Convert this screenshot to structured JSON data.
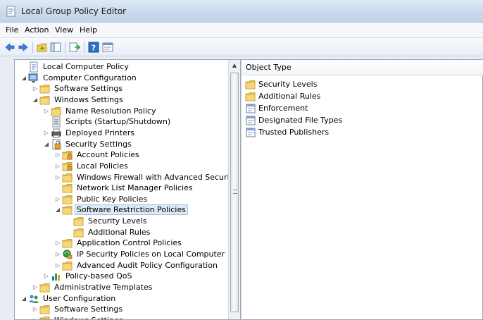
{
  "window": {
    "title": "Local Group Policy Editor"
  },
  "menu": [
    "File",
    "Action",
    "View",
    "Help"
  ],
  "toolbar": {
    "buttons": [
      "back-icon",
      "forward-icon",
      "up-folder-icon",
      "show-hide-tree-icon",
      "export-list-icon",
      "help-icon",
      "properties-icon"
    ]
  },
  "tree": {
    "items": [
      {
        "label": "Local Computer Policy",
        "level": 0,
        "expander": "none",
        "icon": "policy"
      },
      {
        "label": "Computer Configuration",
        "level": 0,
        "expander": "expanded",
        "icon": "computer"
      },
      {
        "label": "Software Settings",
        "level": 1,
        "expander": "collapsed",
        "icon": "folder"
      },
      {
        "label": "Windows Settings",
        "level": 1,
        "expander": "expanded",
        "icon": "folder"
      },
      {
        "label": "Name Resolution Policy",
        "level": 2,
        "expander": "collapsed",
        "icon": "folder"
      },
      {
        "label": "Scripts (Startup/Shutdown)",
        "level": 2,
        "expander": "none",
        "icon": "script"
      },
      {
        "label": "Deployed Printers",
        "level": 2,
        "expander": "collapsed",
        "icon": "printer"
      },
      {
        "label": "Security Settings",
        "level": 2,
        "expander": "expanded",
        "icon": "security"
      },
      {
        "label": "Account Policies",
        "level": 3,
        "expander": "collapsed",
        "icon": "folder-lock"
      },
      {
        "label": "Local Policies",
        "level": 3,
        "expander": "collapsed",
        "icon": "folder-lock"
      },
      {
        "label": "Windows Firewall with Advanced Security",
        "level": 3,
        "expander": "collapsed",
        "icon": "folder"
      },
      {
        "label": "Network List Manager Policies",
        "level": 3,
        "expander": "none",
        "icon": "folder"
      },
      {
        "label": "Public Key Policies",
        "level": 3,
        "expander": "collapsed",
        "icon": "folder"
      },
      {
        "label": "Software Restriction Policies",
        "level": 3,
        "expander": "expanded",
        "icon": "folder",
        "selected": true
      },
      {
        "label": "Security Levels",
        "level": 4,
        "expander": "none",
        "icon": "folder"
      },
      {
        "label": "Additional Rules",
        "level": 4,
        "expander": "none",
        "icon": "folder"
      },
      {
        "label": "Application Control Policies",
        "level": 3,
        "expander": "collapsed",
        "icon": "folder"
      },
      {
        "label": "IP Security Policies on Local Computer",
        "level": 3,
        "expander": "collapsed",
        "icon": "ipsec"
      },
      {
        "label": "Advanced Audit Policy Configuration",
        "level": 3,
        "expander": "collapsed",
        "icon": "folder"
      },
      {
        "label": "Policy-based QoS",
        "level": 2,
        "expander": "collapsed",
        "icon": "chart"
      },
      {
        "label": "Administrative Templates",
        "level": 1,
        "expander": "collapsed",
        "icon": "folder"
      },
      {
        "label": "User Configuration",
        "level": 0,
        "expander": "expanded",
        "icon": "user"
      },
      {
        "label": "Software Settings",
        "level": 1,
        "expander": "collapsed",
        "icon": "folder"
      },
      {
        "label": "Windows Settings",
        "level": 1,
        "expander": "collapsed",
        "icon": "folder"
      }
    ]
  },
  "list": {
    "column_header": "Object Type",
    "items": [
      {
        "label": "Security Levels",
        "icon": "folder"
      },
      {
        "label": "Additional Rules",
        "icon": "folder"
      },
      {
        "label": "Enforcement",
        "icon": "setting"
      },
      {
        "label": "Designated File Types",
        "icon": "setting"
      },
      {
        "label": "Trusted Publishers",
        "icon": "setting"
      }
    ]
  },
  "colors": {
    "folder": "#f2c74e",
    "selection": "#dde8f5",
    "accent": "#2b6cc4"
  }
}
